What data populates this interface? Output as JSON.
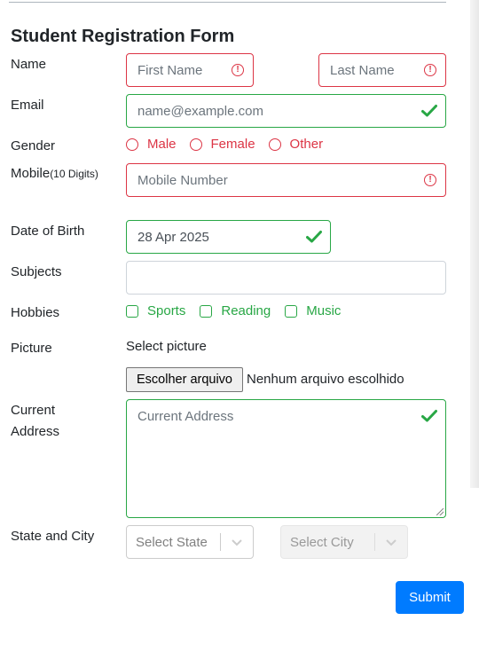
{
  "form": {
    "title": "Student Registration Form",
    "labels": {
      "name": "Name",
      "email": "Email",
      "gender": "Gender",
      "mobile": "Mobile",
      "mobile_hint": "(10 Digits)",
      "dob": "Date of Birth",
      "subjects": "Subjects",
      "hobbies": "Hobbies",
      "picture": "Picture",
      "current_address_line1": "Current",
      "current_address_line2": "Address",
      "state_city": "State and City"
    },
    "first_name_placeholder": "First Name",
    "last_name_placeholder": "Last Name",
    "email_placeholder": "name@example.com",
    "gender_options": [
      "Male",
      "Female",
      "Other"
    ],
    "mobile_placeholder": "Mobile Number",
    "dob_value": "28 Apr 2025",
    "subjects_value": "",
    "hobbies_options": [
      "Sports",
      "Reading",
      "Music"
    ],
    "picture_label": "Select picture",
    "file_button": "Escolher arquivo",
    "file_status": "Nenhum arquivo escolhido",
    "address_placeholder": "Current Address",
    "state_placeholder": "Select State",
    "city_placeholder": "Select City",
    "submit": "Submit"
  },
  "colors": {
    "invalid": "#dc3545",
    "valid": "#28a745",
    "primary": "#007bff"
  },
  "icons": {
    "invalid": "exclamation-circle-icon",
    "valid": "checkmark-icon",
    "dropdown": "chevron-down-icon"
  }
}
